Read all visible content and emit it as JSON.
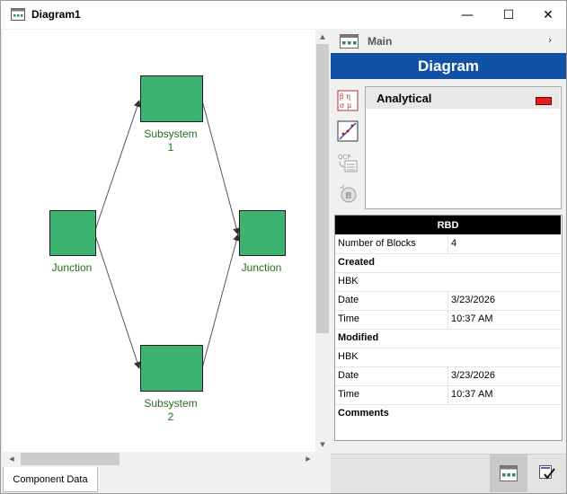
{
  "window": {
    "title": "Diagram1",
    "minimize_glyph": "—",
    "maximize_glyph": "☐",
    "close_glyph": "✕"
  },
  "canvas": {
    "blocks": [
      {
        "id": "junction-left",
        "label": "Junction"
      },
      {
        "id": "subsystem-1",
        "label": "Subsystem\n1"
      },
      {
        "id": "subsystem-2",
        "label": "Subsystem\n2"
      },
      {
        "id": "junction-right",
        "label": "Junction"
      }
    ],
    "block_color": "#3cb371",
    "label_color": "#1e6f1e",
    "scroll_up": "▲",
    "scroll_down": "▼",
    "scroll_left": "◀",
    "scroll_right": "▶"
  },
  "bottom_tabs": {
    "component_data": "Component Data"
  },
  "panel": {
    "main_label": "Main",
    "chevron": "›",
    "banner": "Diagram",
    "banner_color": "#1151a6",
    "tools": [
      "distribution-symbols-icon",
      "plot-icon",
      "qcp-calculator-icon",
      "bx-icon"
    ],
    "analytics": {
      "label": "Analytical",
      "indicator_color": "#e01e1e"
    }
  },
  "rbd": {
    "header": "RBD",
    "rows": [
      {
        "key": "Number of Blocks",
        "value": "4",
        "bold": false
      },
      {
        "key": "Created",
        "value": "",
        "bold": true
      },
      {
        "key": "HBK",
        "value": "",
        "bold": false
      },
      {
        "key": "Date",
        "value": "3/23/2026",
        "bold": false
      },
      {
        "key": "Time",
        "value": "10:37 AM",
        "bold": false
      },
      {
        "key": "Modified",
        "value": "",
        "bold": true
      },
      {
        "key": "HBK",
        "value": "",
        "bold": false
      },
      {
        "key": "Date",
        "value": "3/23/2026",
        "bold": false
      },
      {
        "key": "Time",
        "value": "10:37 AM",
        "bold": false
      },
      {
        "key": "Comments",
        "value": "",
        "bold": true
      }
    ]
  },
  "footer": {
    "buttons": [
      "diagram-view-icon",
      "checklist-icon"
    ]
  }
}
